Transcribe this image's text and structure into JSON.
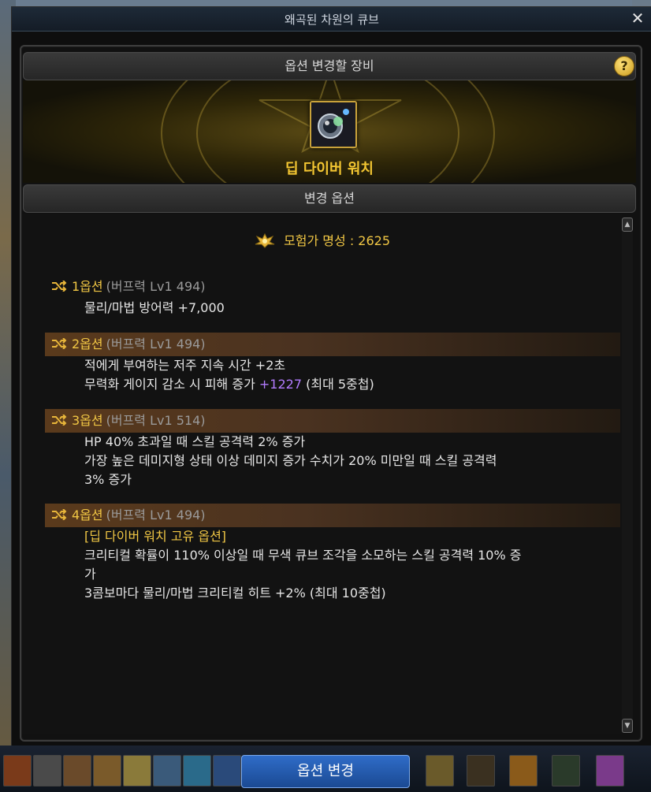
{
  "window": {
    "title": "왜곡된 차원의 큐브",
    "close_symbol": "✕"
  },
  "equip_section": {
    "header": "옵션 변경할 장비",
    "help_symbol": "?",
    "item_name": "딥 다이버 워치"
  },
  "options_section": {
    "header": "변경 옵션",
    "fame_label": "모험가 명성 : 2625",
    "options": [
      {
        "num": "1옵션",
        "sub": "(버프력 Lv1 494)",
        "lines": [
          "물리/마법 방어력 +7,000"
        ]
      },
      {
        "num": "2옵션",
        "sub": "(버프력 Lv1 494)",
        "line1": "적에게 부여하는 저주 지속 시간 +2초",
        "line2_prefix": "무력화 게이지 감소 시 피해 증가",
        "line2_value": "+1227",
        "line2_suffix": "(최대 5중첩)"
      },
      {
        "num": "3옵션",
        "sub": "(버프력 Lv1 514)",
        "lines": [
          "HP 40% 초과일 때 스킬 공격력 2% 증가",
          "가장 높은 데미지형 상태 이상 데미지 증가 수치가 20% 미만일 때 스킬 공격력",
          "3% 증가"
        ]
      },
      {
        "num": "4옵션",
        "sub": "(버프력 Lv1 494)",
        "lines": [
          "[딥 다이버 워치 고유 옵션]",
          "크리티컬 확률이 110% 이상일 때 무색 큐브 조각을 소모하는 스킬 공격력 10% 증",
          "가",
          "3콤보마다 물리/마법 크리티컬 히트 +2% (최대 10중첩)"
        ]
      }
    ]
  },
  "scroll": {
    "up": "▲",
    "down": "▼"
  },
  "footer": {
    "change_button": "옵션 변경"
  },
  "colors": {
    "gold": "#f0c644",
    "purple": "#b27cff",
    "button_blue": "#2f6cc8"
  }
}
